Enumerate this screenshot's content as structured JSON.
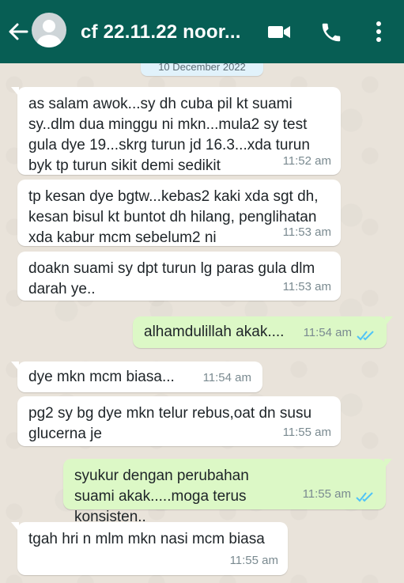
{
  "header": {
    "contact_name": "cf 22.11.22 noor...",
    "back_icon": "arrow-left-icon",
    "video_icon": "video-camera-icon",
    "call_icon": "phone-icon",
    "menu_icon": "more-vertical-icon",
    "color": "#075e54"
  },
  "chat": {
    "date_label": "10 December 2022",
    "messages": [
      {
        "direction": "incoming",
        "text": "as salam awok...sy dh cuba pil kt suami sy..dlm dua minggu ni mkn...mula2 sy test gula dye 19...skrg turun jd 16.3...xda turun byk tp turun sikit demi sedikit",
        "time": "11:52 am"
      },
      {
        "direction": "incoming",
        "text": "tp kesan dye bgtw...kebas2 kaki xda sgt dh, kesan bisul kt buntot dh hilang, penglihatan xda kabur mcm sebelum2 ni",
        "time": "11:53 am"
      },
      {
        "direction": "incoming",
        "text": "doakn suami sy dpt turun lg paras gula dlm darah ye..",
        "time": "11:53 am"
      },
      {
        "direction": "outgoing",
        "text": "alhamdulillah akak....",
        "time": "11:54 am",
        "read": true
      },
      {
        "direction": "incoming",
        "text": "dye mkn mcm biasa...",
        "time": "11:54 am"
      },
      {
        "direction": "incoming",
        "text": "pg2 sy bg dye mkn telur rebus,oat dn susu glucerna je",
        "time": "11:55 am"
      },
      {
        "direction": "outgoing",
        "text": "syukur dengan perubahan suami akak.....moga terus konsisten..",
        "time": "11:55 am",
        "read": true
      },
      {
        "direction": "incoming",
        "text": "tgah hri n mlm mkn nasi mcm biasa",
        "time": "11:55 am"
      }
    ],
    "colors": {
      "incoming_bubble": "#ffffff",
      "outgoing_bubble": "#dcf8c6",
      "read_ticks": "#4fc3f7"
    }
  }
}
